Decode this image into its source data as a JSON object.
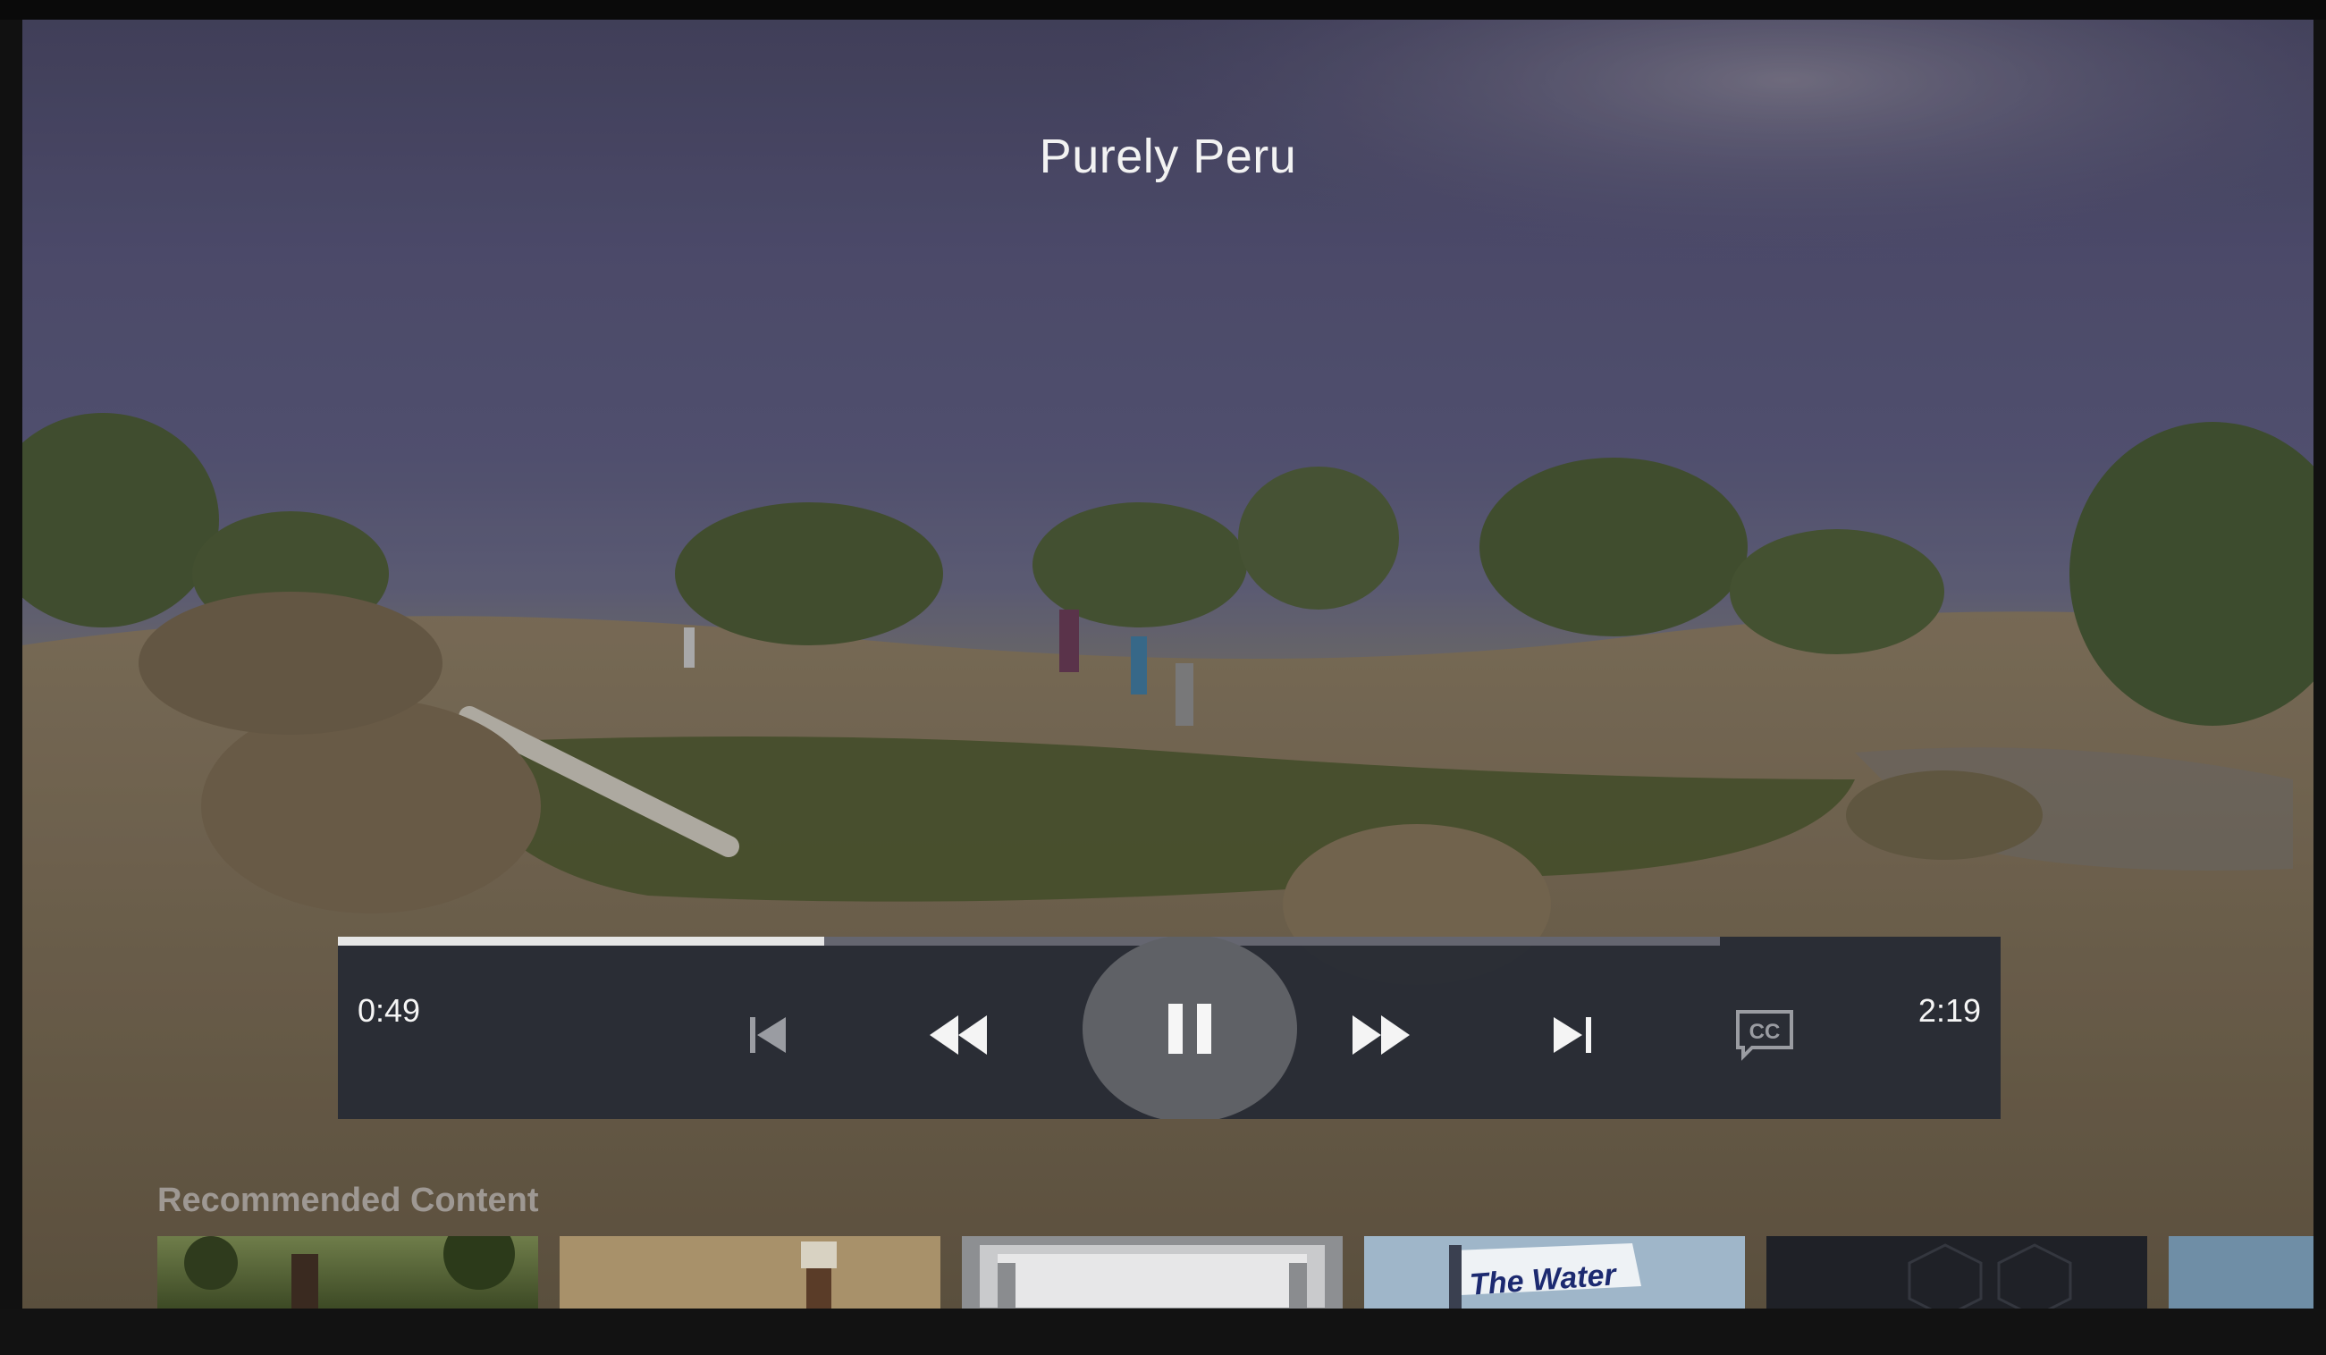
{
  "player": {
    "title": "Purely Peru",
    "elapsed": "0:49",
    "duration": "2:19",
    "progress": 0.352
  },
  "controls": {
    "skip_previous_icon": "skip-previous-icon",
    "rewind_icon": "rewind-icon",
    "pause_icon": "pause-icon",
    "fast_forward_icon": "fast-forward-icon",
    "skip_next_icon": "skip-next-icon",
    "captions_icon": "closed-captions-icon",
    "captions_label": "CC"
  },
  "recommended": {
    "heading": "Recommended Content",
    "items": [
      {
        "label": ""
      },
      {
        "label": ""
      },
      {
        "label": ""
      },
      {
        "label": "The Water"
      },
      {
        "label": ""
      },
      {
        "label": ""
      }
    ]
  },
  "colors": {
    "control_bar": "#262a34",
    "play_button": "#5f6166",
    "progress_fill": "#e6e6e6"
  }
}
